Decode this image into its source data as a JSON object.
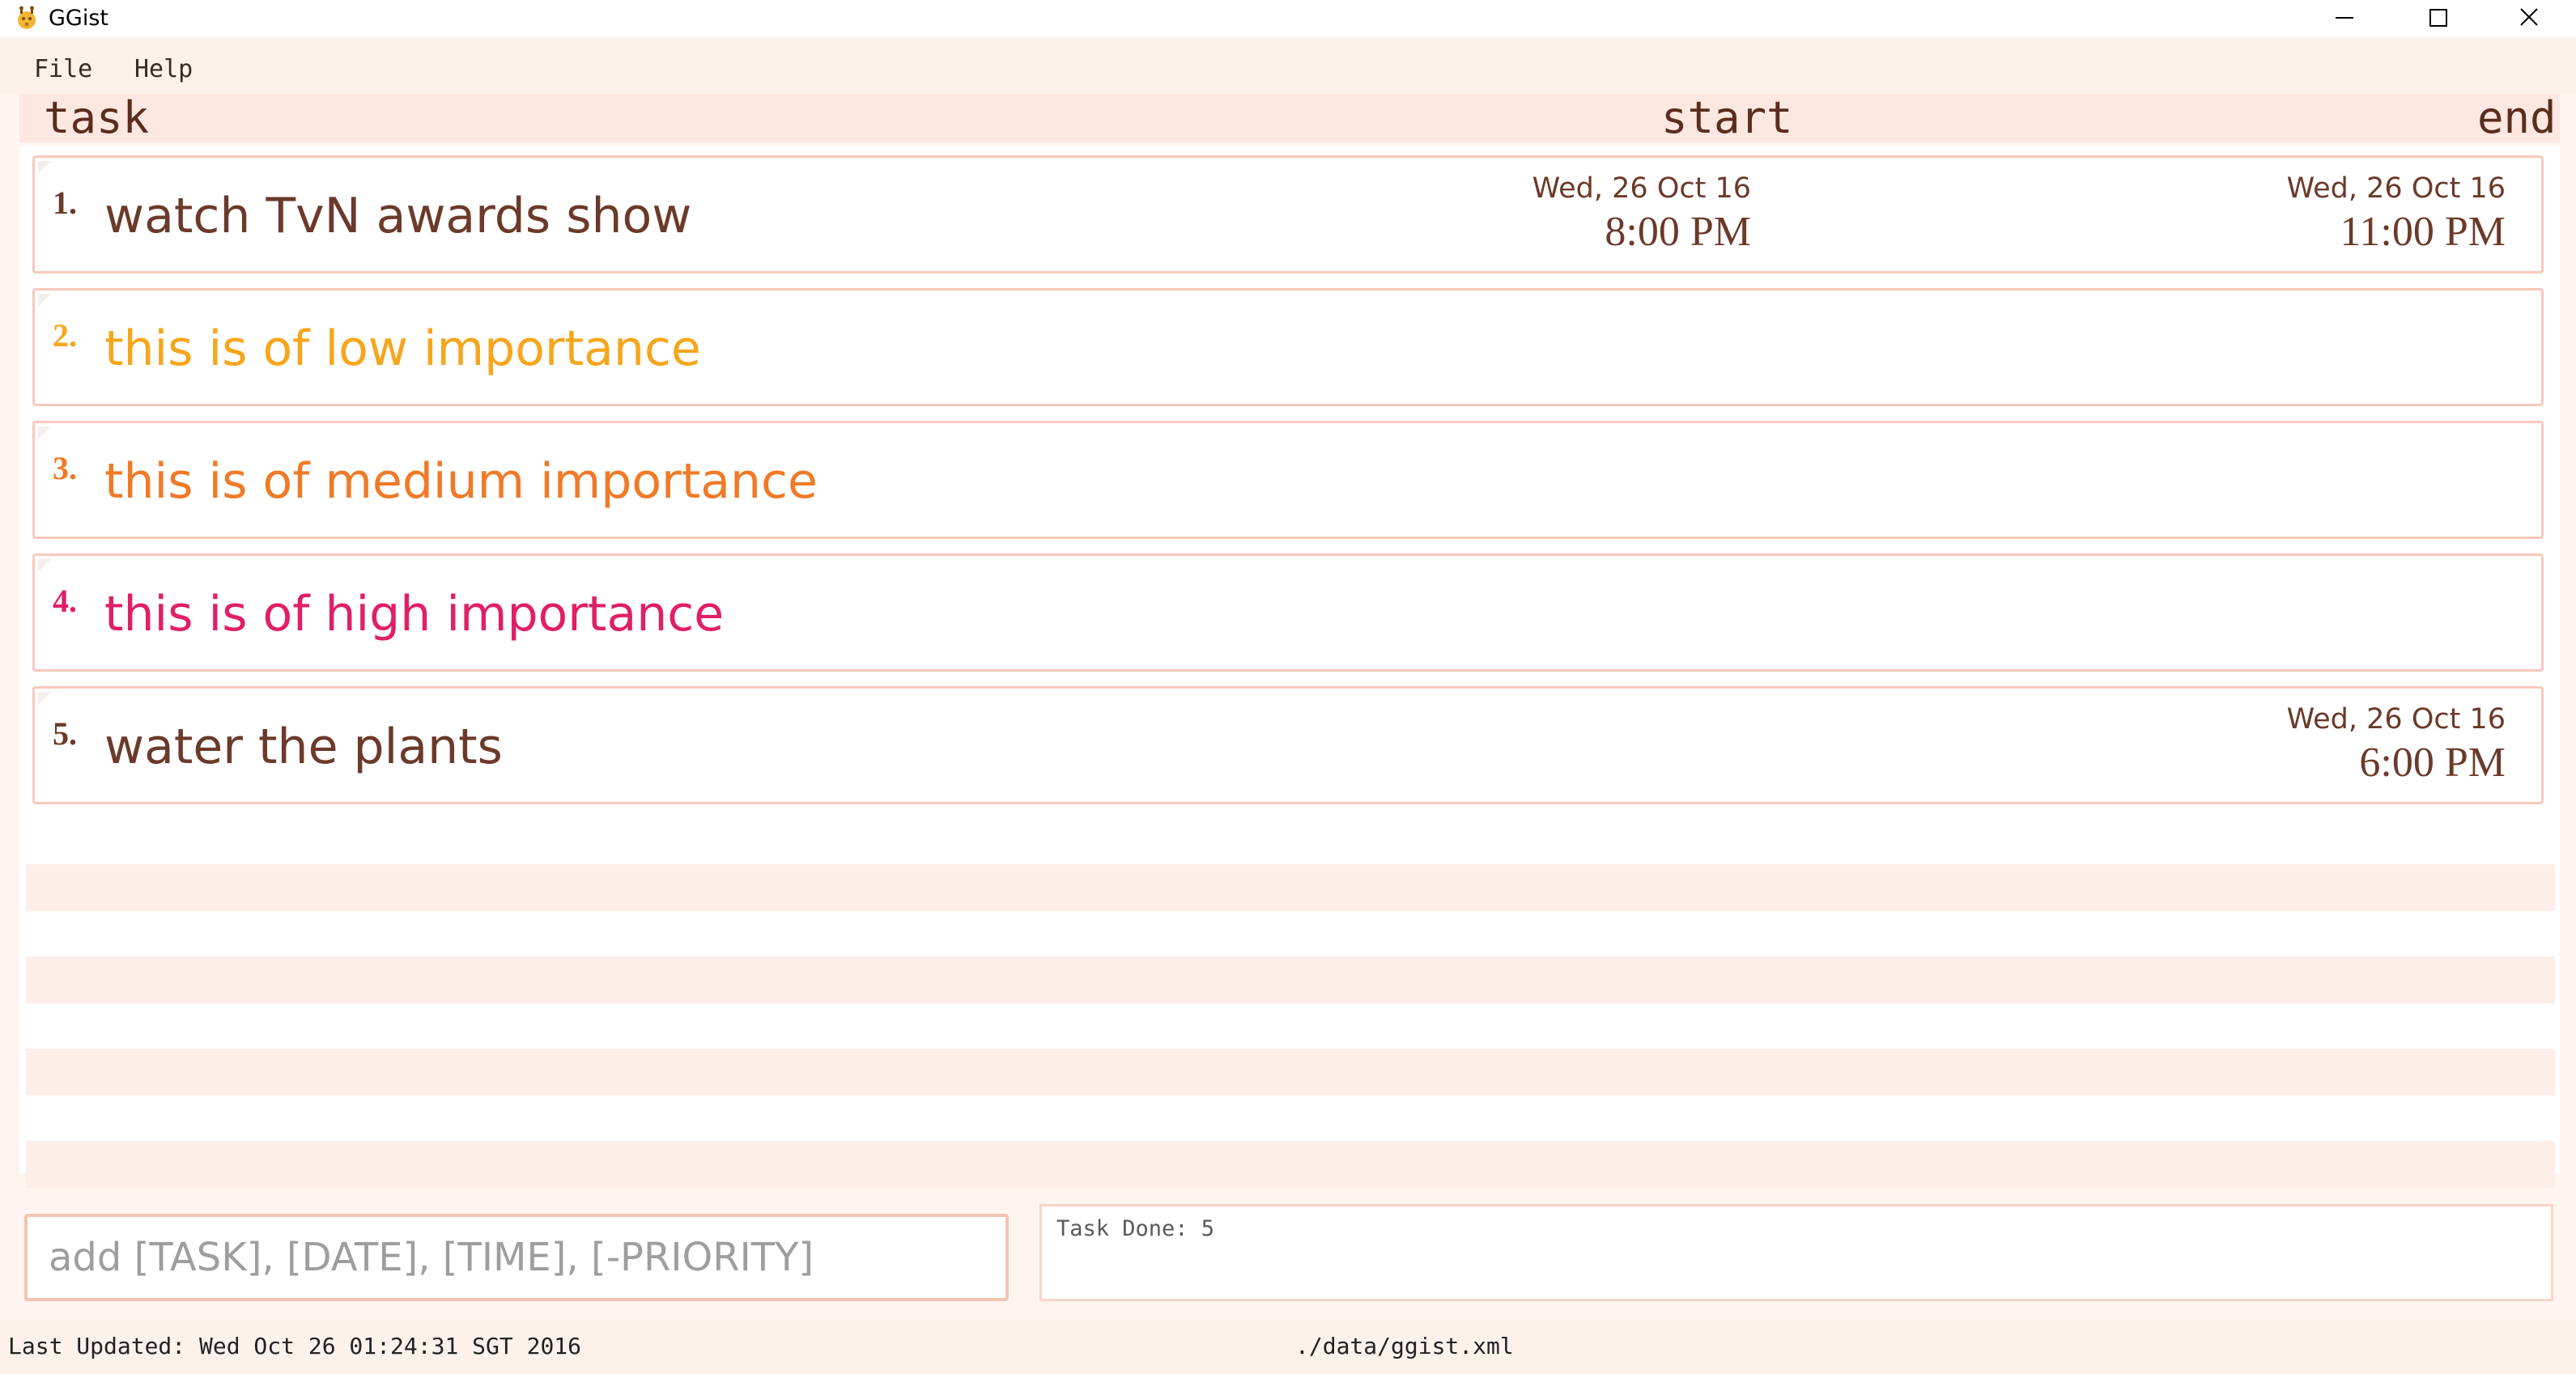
{
  "window": {
    "title": "GGist"
  },
  "menu": {
    "items": [
      "File",
      "Help"
    ]
  },
  "columns": {
    "task": "task",
    "start": "start",
    "end": "end"
  },
  "tasks": [
    {
      "index": "1.",
      "name": "watch TvN awards show",
      "priority": "normal",
      "start_date": "Wed, 26 Oct 16",
      "start_time": "8:00 PM",
      "end_date": "Wed, 26 Oct 16",
      "end_time": "11:00 PM"
    },
    {
      "index": "2.",
      "name": "this is of low importance",
      "priority": "low",
      "start_date": "",
      "start_time": "",
      "end_date": "",
      "end_time": ""
    },
    {
      "index": "3.",
      "name": "this is of medium importance",
      "priority": "medium",
      "start_date": "",
      "start_time": "",
      "end_date": "",
      "end_time": ""
    },
    {
      "index": "4.",
      "name": "this is of high importance",
      "priority": "high",
      "start_date": "",
      "start_time": "",
      "end_date": "",
      "end_time": ""
    },
    {
      "index": "5.",
      "name": "water the plants",
      "priority": "normal",
      "start_date": "",
      "start_time": "",
      "end_date": "Wed, 26 Oct 16",
      "end_time": "6:00 PM"
    }
  ],
  "priority_colors": {
    "normal": "#6b3a2a",
    "low": "#f6a61c",
    "medium": "#f07a26",
    "high": "#e01f67"
  },
  "command": {
    "value": "",
    "placeholder": "add [TASK], [DATE], [TIME], [-PRIORITY]"
  },
  "result": {
    "text": "Task Done: 5"
  },
  "status": {
    "last_updated": "Last Updated: Wed Oct 26 01:24:31 SGT 2016",
    "file_path": "./data/ggist.xml"
  }
}
